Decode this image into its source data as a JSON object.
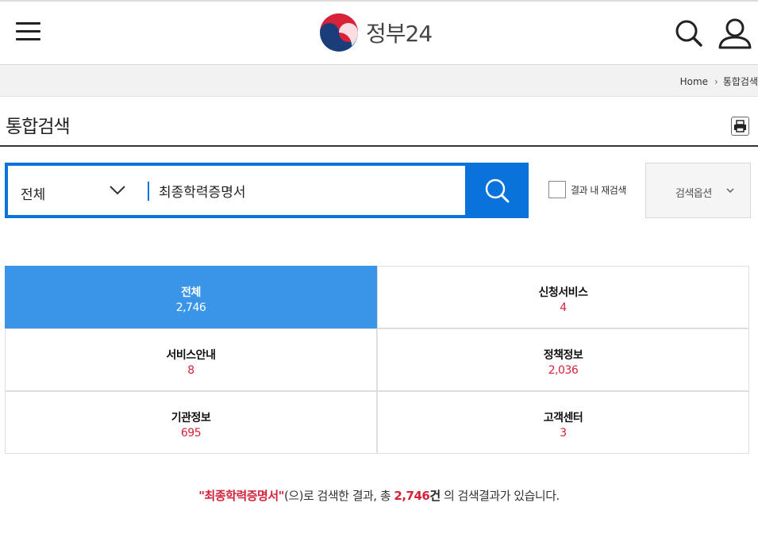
{
  "header": {
    "logo_text": "정부24",
    "menu_icon": "hamburger-menu-icon",
    "search_icon": "search-icon",
    "user_icon": "user-icon"
  },
  "breadcrumb": {
    "home": "Home",
    "current": "통합검색"
  },
  "page": {
    "title": "통합검색",
    "print_icon": "printer-icon"
  },
  "search": {
    "category": "전체",
    "query": "최종학력증명서",
    "within_results_label": "결과 내 재검색",
    "within_results_checked": false,
    "options_label": "검색옵션"
  },
  "categories": [
    {
      "name": "전체",
      "count": "2,746",
      "active": true
    },
    {
      "name": "신청서비스",
      "count": "4",
      "active": false
    },
    {
      "name": "서비스안내",
      "count": "8",
      "active": false
    },
    {
      "name": "정책정보",
      "count": "2,036",
      "active": false
    },
    {
      "name": "기관정보",
      "count": "695",
      "active": false
    },
    {
      "name": "고객센터",
      "count": "3",
      "active": false
    }
  ],
  "summary": {
    "keyword": "\"최종학력증명서\"",
    "text1": "(으)로 검색한 결과, 총 ",
    "count": "2,746",
    "unit": "건",
    "text2": " 의 검색결과가 있습니다."
  },
  "colors": {
    "primary_blue": "#0a72db",
    "active_tab": "#3a95e9",
    "count_red": "#d4223a"
  }
}
